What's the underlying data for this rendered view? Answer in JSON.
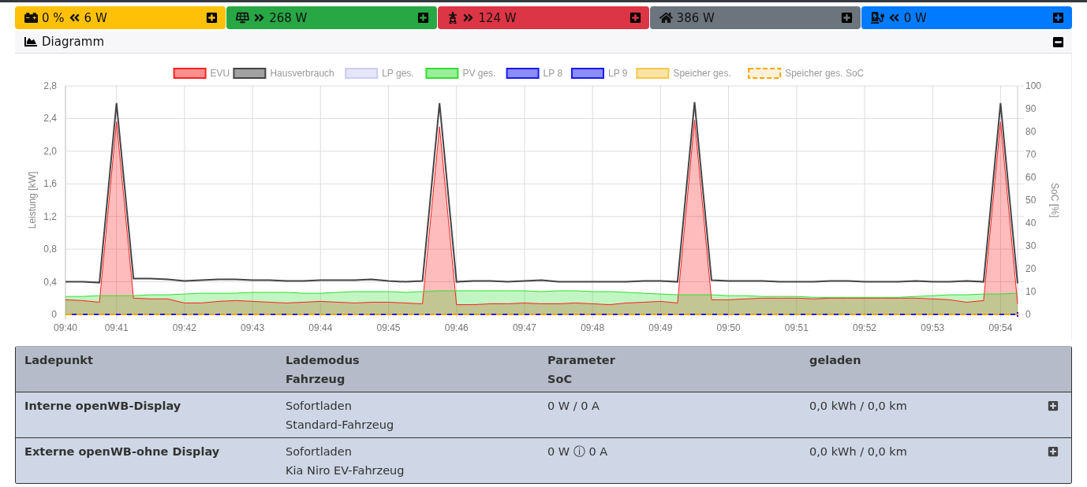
{
  "power_cards": [
    {
      "kind": "battery",
      "color": "#ffc107",
      "prefix": "0 %",
      "outgoing": false,
      "value": "6 W"
    },
    {
      "kind": "solar",
      "color": "#28a745",
      "outgoing": true,
      "value": "268 W"
    },
    {
      "kind": "pylon",
      "color": "#dc3545",
      "outgoing": true,
      "value": "124 W"
    },
    {
      "kind": "house",
      "color": "#6c757d",
      "value": "386 W"
    },
    {
      "kind": "charger",
      "color": "#007bff",
      "outgoing": false,
      "value": "0 W"
    }
  ],
  "diagram": {
    "title": "Diagramm",
    "expanded": true,
    "chart_data": {
      "type": "line",
      "grid": true,
      "legend": true,
      "ylabel": "Leistung [kW]",
      "y2label": "SoC [%]",
      "categories": [
        "09:40",
        null,
        null,
        "09:41",
        null,
        null,
        null,
        "09:42",
        null,
        null,
        null,
        "09:43",
        null,
        null,
        null,
        "09:44",
        null,
        null,
        null,
        "09:45",
        null,
        null,
        null,
        "09:46",
        null,
        null,
        null,
        "09:47",
        null,
        null,
        null,
        "09:48",
        null,
        null,
        null,
        "09:49",
        null,
        null,
        null,
        "09:50",
        null,
        null,
        null,
        "09:51",
        null,
        null,
        null,
        "09:52",
        null,
        null,
        null,
        "09:53",
        null,
        null,
        null,
        "09:54",
        null
      ],
      "ylim": [
        0,
        2.8
      ],
      "yticks": [
        {
          "value": 0,
          "label": "0"
        },
        {
          "value": 0.4,
          "label": "0,4"
        },
        {
          "value": 0.8,
          "label": "0,8"
        },
        {
          "value": 1.2,
          "label": "1,2"
        },
        {
          "value": 1.6,
          "label": "1,6"
        },
        {
          "value": 2.0,
          "label": "2,0"
        },
        {
          "value": 2.4,
          "label": "2,4"
        },
        {
          "value": 2.8,
          "label": "2,8"
        }
      ],
      "y2lim": [
        0,
        100
      ],
      "y2ticks": [
        0,
        10,
        20,
        30,
        40,
        50,
        60,
        70,
        80,
        90,
        100
      ],
      "series": [
        {
          "name": "EVU",
          "color": "#ff2020",
          "type": "area",
          "values": [
            0.18,
            0.17,
            0.15,
            2.36,
            0.2,
            0.19,
            0.19,
            0.14,
            0.14,
            0.16,
            0.17,
            0.16,
            0.15,
            0.14,
            0.15,
            0.16,
            0.15,
            0.14,
            0.15,
            0.15,
            0.14,
            0.13,
            2.3,
            0.12,
            0.12,
            0.13,
            0.13,
            0.14,
            0.13,
            0.13,
            0.14,
            0.13,
            0.12,
            0.14,
            0.15,
            0.16,
            0.14,
            2.38,
            0.18,
            0.18,
            0.19,
            0.2,
            0.2,
            0.2,
            0.19,
            0.2,
            0.2,
            0.2,
            0.2,
            0.2,
            0.2,
            0.19,
            0.18,
            0.15,
            0.17,
            2.36,
            0.13
          ]
        },
        {
          "name": "Hausverbrauch",
          "color": "#444444",
          "values": [
            0.4,
            0.4,
            0.39,
            2.59,
            0.44,
            0.44,
            0.43,
            0.41,
            0.42,
            0.43,
            0.43,
            0.42,
            0.42,
            0.41,
            0.41,
            0.42,
            0.42,
            0.42,
            0.43,
            0.41,
            0.4,
            0.41,
            2.59,
            0.4,
            0.41,
            0.41,
            0.4,
            0.41,
            0.42,
            0.4,
            0.4,
            0.4,
            0.4,
            0.4,
            0.41,
            0.41,
            0.4,
            2.6,
            0.42,
            0.41,
            0.41,
            0.41,
            0.4,
            0.4,
            0.4,
            0.41,
            0.41,
            0.4,
            0.4,
            0.4,
            0.41,
            0.4,
            0.4,
            0.41,
            0.4,
            2.59,
            0.38
          ]
        },
        {
          "name": "LP ges.",
          "color": "#ccccf5",
          "values": [
            null,
            null,
            null,
            null,
            null,
            null,
            null,
            null,
            null,
            null,
            null,
            null,
            null,
            null,
            null,
            null,
            null,
            null,
            null,
            null,
            null,
            null,
            null,
            null,
            null,
            null,
            null,
            null,
            null,
            null,
            null,
            null,
            null,
            null,
            null,
            null,
            null,
            null,
            null,
            null,
            null,
            null,
            null,
            null,
            null,
            null,
            null,
            null,
            null,
            null,
            null,
            null,
            null,
            null,
            null,
            null,
            null
          ]
        },
        {
          "name": "PV ges.",
          "color": "#33dd33",
          "type": "area",
          "values": [
            0.22,
            0.22,
            0.23,
            0.23,
            0.23,
            0.24,
            0.24,
            0.25,
            0.26,
            0.26,
            0.26,
            0.27,
            0.27,
            0.27,
            0.26,
            0.26,
            0.27,
            0.28,
            0.28,
            0.28,
            0.27,
            0.28,
            0.29,
            0.29,
            0.29,
            0.29,
            0.29,
            0.29,
            0.28,
            0.29,
            0.29,
            0.28,
            0.28,
            0.27,
            0.26,
            0.25,
            0.24,
            0.24,
            0.24,
            0.23,
            0.23,
            0.22,
            0.22,
            0.22,
            0.21,
            0.21,
            0.21,
            0.21,
            0.21,
            0.21,
            0.22,
            0.23,
            0.24,
            0.24,
            0.25,
            0.25,
            0.26
          ]
        },
        {
          "name": "LP 8",
          "color": "#1a1aee",
          "values": [
            null,
            null,
            null,
            null,
            null,
            null,
            null,
            null,
            null,
            null,
            null,
            null,
            null,
            null,
            null,
            null,
            null,
            null,
            null,
            null,
            null,
            null,
            null,
            null,
            null,
            null,
            null,
            null,
            null,
            null,
            null,
            null,
            null,
            null,
            null,
            null,
            null,
            null,
            null,
            null,
            null,
            null,
            null,
            null,
            null,
            null,
            null,
            null,
            null,
            null,
            null,
            null,
            null,
            null,
            null,
            null,
            null
          ]
        },
        {
          "name": "LP 9",
          "color": "#1a1aee",
          "values": [
            0,
            0,
            0,
            0,
            0,
            0,
            0,
            0,
            0,
            0,
            0,
            0,
            0,
            0,
            0,
            0,
            0,
            0,
            0,
            0,
            0,
            0,
            0,
            0,
            0,
            0,
            0,
            0,
            0,
            0,
            0,
            0,
            0,
            0,
            0,
            0,
            0,
            0,
            0,
            0,
            0,
            0,
            0,
            0,
            0,
            0,
            0,
            0,
            0,
            0,
            0,
            0,
            0,
            0,
            0,
            0,
            0
          ]
        },
        {
          "name": "Speicher ges.",
          "color": "#f5c84a",
          "values": [
            null,
            null,
            null,
            null,
            null,
            null,
            null,
            null,
            null,
            null,
            null,
            null,
            null,
            null,
            null,
            null,
            null,
            null,
            null,
            null,
            null,
            null,
            null,
            null,
            null,
            null,
            null,
            null,
            null,
            null,
            null,
            null,
            null,
            null,
            null,
            null,
            null,
            null,
            null,
            null,
            null,
            null,
            null,
            null,
            null,
            null,
            null,
            null,
            null,
            null,
            null,
            null,
            null,
            null,
            null,
            null,
            null
          ]
        },
        {
          "name": "Speicher ges. SoC",
          "color": "#ffa500",
          "axis": "y2",
          "line_style": "dashed",
          "values": [
            0,
            0,
            0,
            0,
            0,
            0,
            0,
            0,
            0,
            0,
            0,
            0,
            0,
            0,
            0,
            0,
            0,
            0,
            0,
            0,
            0,
            0,
            0,
            0,
            0,
            0,
            0,
            0,
            0,
            0,
            0,
            0,
            0,
            0,
            0,
            0,
            0,
            0,
            0,
            0,
            0,
            0,
            0,
            0,
            0,
            0,
            0,
            0,
            0,
            0,
            0,
            0,
            0,
            0,
            0,
            0,
            0
          ]
        }
      ]
    }
  },
  "charge_table": {
    "columns": [
      [
        "Ladepunkt"
      ],
      [
        "Lademodus",
        "Fahrzeug"
      ],
      [
        "Parameter",
        "SoC"
      ],
      [
        "geladen"
      ]
    ],
    "rows": [
      {
        "name": "Interne openWB-Display",
        "mode": "Sofortladen",
        "vehicle": "Standard-Fahrzeug",
        "parameter": "0 W / 0 A",
        "charged": "0,0 kWh / 0,0 km",
        "expanded": false
      },
      {
        "name": "Externe openWB-ohne Display",
        "mode": "Sofortladen",
        "vehicle": "Kia Niro EV-Fahrzeug",
        "parameter": "0 W ⓘ 0 A",
        "charged": "0,0 kWh / 0,0 km",
        "expanded": false
      }
    ]
  }
}
